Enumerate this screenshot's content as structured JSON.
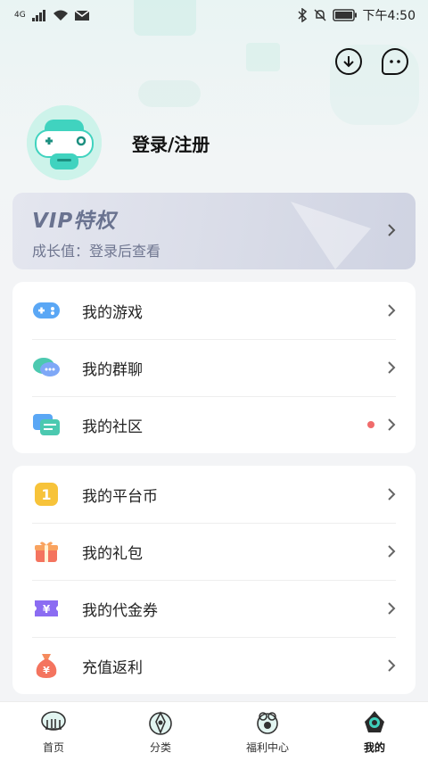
{
  "status_bar": {
    "network": "4G",
    "time": "下午4:50"
  },
  "profile": {
    "login_label": "登录/注册"
  },
  "vip": {
    "title": "VIP特权",
    "subtitle": "成长值：登录后查看"
  },
  "menu_group_1": [
    {
      "label": "我的游戏",
      "icon": "gamepad-icon"
    },
    {
      "label": "我的群聊",
      "icon": "chat-bubbles-icon"
    },
    {
      "label": "我的社区",
      "icon": "community-icon",
      "badge": "red-dot"
    }
  ],
  "menu_group_2": [
    {
      "label": "我的平台币",
      "icon": "coin-icon"
    },
    {
      "label": "我的礼包",
      "icon": "gift-icon"
    },
    {
      "label": "我的代金券",
      "icon": "voucher-icon"
    },
    {
      "label": "充值返利",
      "icon": "money-bag-icon"
    }
  ],
  "tabbar": [
    {
      "label": "首页",
      "icon": "home-icon"
    },
    {
      "label": "分类",
      "icon": "category-icon"
    },
    {
      "label": "福利中心",
      "icon": "welfare-icon"
    },
    {
      "label": "我的",
      "icon": "mine-icon",
      "active": true
    }
  ],
  "colors": {
    "accent_teal": "#3fd0bc",
    "badge_red": "#f06b6b",
    "vip_text": "#6a7390"
  }
}
